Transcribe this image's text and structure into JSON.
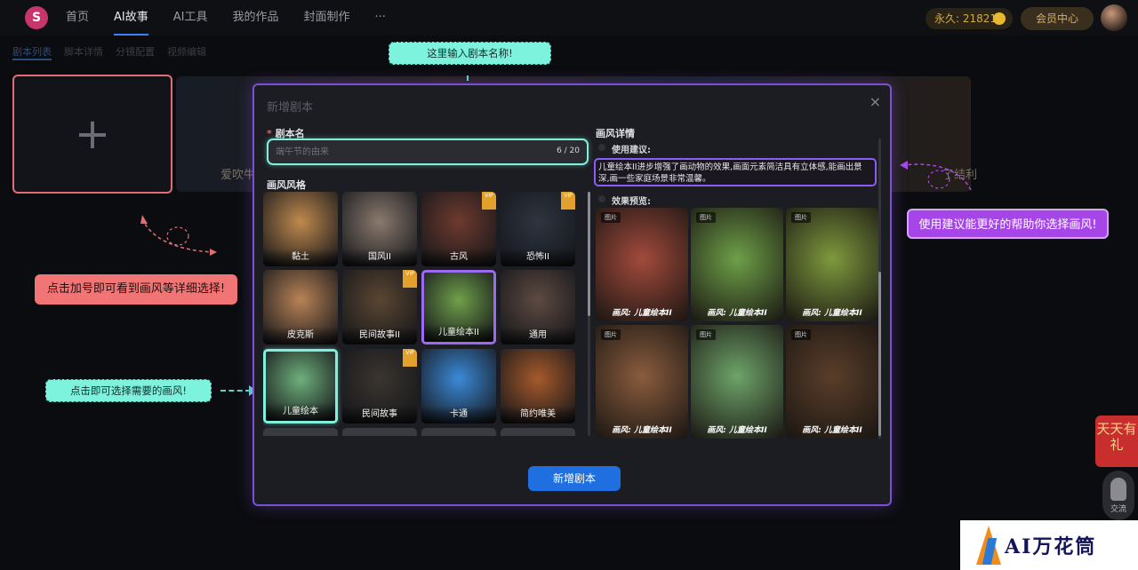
{
  "nav": {
    "items": [
      "首页",
      "AI故事",
      "AI工具",
      "我的作品",
      "封面制作",
      "···"
    ],
    "active_index": 1,
    "coins": "永久: 21821",
    "vip": "会员中心"
  },
  "subnav": [
    "剧本列表",
    "脚本详情",
    "分镜配置",
    "视频编辑"
  ],
  "background": {
    "card1_text": "爱吹牛",
    "card2_text": "了结利"
  },
  "callouts": {
    "title_hint": "这里输入剧本名称!",
    "plus_hint": "点击加号即可看到画风等详细选择!",
    "style_hint": "点击即可选择需要的画风!",
    "advice_hint": "使用建议能更好的帮助你选择画风!"
  },
  "modal": {
    "title": "新增剧本",
    "close": "×",
    "name_label": "剧本名",
    "name_required": "*",
    "name_placeholder": "端午节的由来",
    "name_counter": "6 / 20",
    "style_label": "画风风格",
    "detail_label": "画风详情",
    "advice_label": "使用建议:",
    "advice_text": "儿童绘本II进步增强了画动物的效果,画面元素简洁具有立体感,能画出景深,画一些家庭场景非常温馨。",
    "preview_label": "效果预览:",
    "submit": "新增剧本"
  },
  "styles": [
    {
      "name": "黏土",
      "color": "#c08a4e",
      "vip": false
    },
    {
      "name": "国风II",
      "color": "#8a7a6e",
      "vip": false
    },
    {
      "name": "古风",
      "color": "#6e3a2e",
      "vip": true
    },
    {
      "name": "恐怖II",
      "color": "#2e3440",
      "vip": true
    },
    {
      "name": "皮克斯",
      "color": "#b98356",
      "vip": false
    },
    {
      "name": "民间故事II",
      "color": "#5a4632",
      "vip": true
    },
    {
      "name": "儿童绘本II",
      "color": "#6fa04a",
      "vip": false
    },
    {
      "name": "通用",
      "color": "#5e4a42",
      "vip": false
    },
    {
      "name": "儿童绘本",
      "color": "#6fb07c",
      "vip": false
    },
    {
      "name": "民间故事",
      "color": "#3a3530",
      "vip": true
    },
    {
      "name": "卡通",
      "color": "#3b8ad8",
      "vip": false
    },
    {
      "name": "简约唯美",
      "color": "#a65a2a",
      "vip": false
    }
  ],
  "selected_style_purple": 6,
  "selected_style_teal": 8,
  "previews": [
    {
      "tag": "图片",
      "caption": "画风: 儿童绘本II",
      "color": "#a34a3c"
    },
    {
      "tag": "图片",
      "caption": "画风: 儿童绘本II",
      "color": "#6ea048"
    },
    {
      "tag": "图片",
      "caption": "画风: 儿童绘本II",
      "color": "#7e9a3e"
    },
    {
      "tag": "图片",
      "caption": "画风: 儿童绘本II",
      "color": "#8a5c3e"
    },
    {
      "tag": "图片",
      "caption": "画风: 儿童绘本II",
      "color": "#6ea46a"
    },
    {
      "tag": "图片",
      "caption": "画风: 儿童绘本II",
      "color": "#5a3e2a"
    }
  ],
  "side": {
    "redpacket": "天天有礼",
    "chat": "交流"
  },
  "brand": "AI万花筒"
}
